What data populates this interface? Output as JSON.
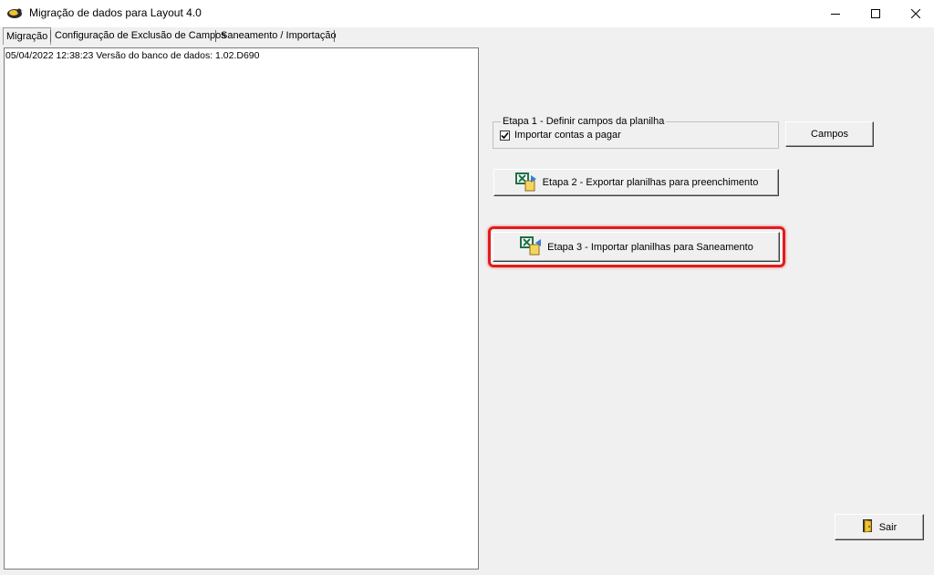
{
  "window": {
    "title": "Migração de dados para Layout 4.0",
    "icon": "app-bird-icon",
    "controls": [
      "minimize-icon",
      "maximize-icon",
      "close-icon"
    ]
  },
  "tabs": [
    {
      "label": "Migração",
      "active": true
    },
    {
      "label": "Configuração de Exclusão de Campos",
      "active": false
    },
    {
      "label": "Saneamento / Importação",
      "active": false
    }
  ],
  "log": {
    "lines": [
      "05/04/2022 12:38:23 Versão do banco de dados: 1.02.D690"
    ]
  },
  "etapa1": {
    "legend": "Etapa 1 - Definir campos da planilha",
    "checkbox_label": "Importar contas a pagar",
    "checked": true,
    "campos_button": "Campos"
  },
  "etapa2": {
    "label": "Etapa 2 - Exportar planilhas para preenchimento",
    "icon": "excel-export-icon"
  },
  "etapa3": {
    "label": "Etapa 3 - Importar planilhas para Saneamento",
    "icon": "excel-import-icon",
    "highlighted": true
  },
  "sair": {
    "label": "Sair",
    "icon": "exit-door-icon"
  },
  "colors": {
    "highlight": "#e21b1b",
    "panel": "#f0f0f0",
    "excel_green": "#1e7145"
  }
}
